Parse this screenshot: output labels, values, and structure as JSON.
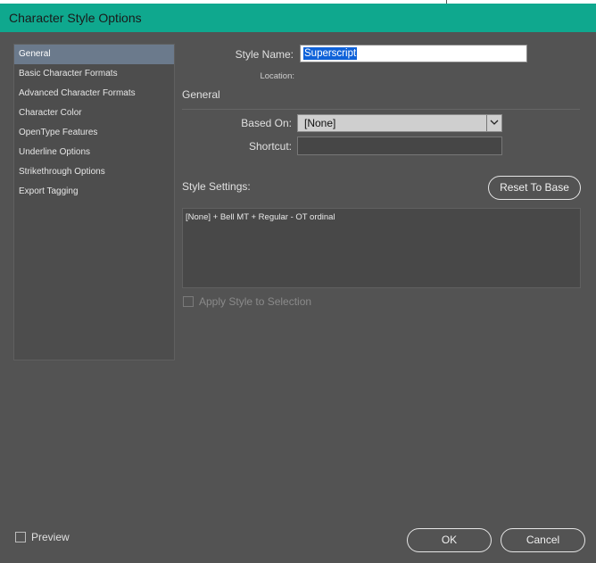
{
  "window": {
    "title": "Character Style Options"
  },
  "sidebar": {
    "items": [
      {
        "label": "General",
        "selected": true
      },
      {
        "label": "Basic Character Formats"
      },
      {
        "label": "Advanced Character Formats"
      },
      {
        "label": "Character Color"
      },
      {
        "label": "OpenType Features"
      },
      {
        "label": "Underline Options"
      },
      {
        "label": "Strikethrough Options"
      },
      {
        "label": "Export Tagging"
      }
    ]
  },
  "form": {
    "style_name_label": "Style Name:",
    "style_name_value": "Superscript",
    "location_label": "Location:",
    "section_title": "General",
    "based_on_label": "Based On:",
    "based_on_value": "[None]",
    "shortcut_label": "Shortcut:",
    "shortcut_value": "",
    "style_settings_label": "Style Settings:",
    "reset_button": "Reset To Base",
    "style_settings_text": "[None] + Bell MT + Regular - OT ordinal",
    "apply_style_label": "Apply Style to Selection",
    "apply_style_checked": false,
    "apply_style_disabled": true
  },
  "footer": {
    "preview_label": "Preview",
    "preview_checked": false,
    "ok_button": "OK",
    "cancel_button": "Cancel"
  },
  "colors": {
    "titlebar": "#0fa88e",
    "dialog_bg": "#535353",
    "selection": "#0f62d9",
    "sidebar_selected": "#6b7a8c"
  }
}
